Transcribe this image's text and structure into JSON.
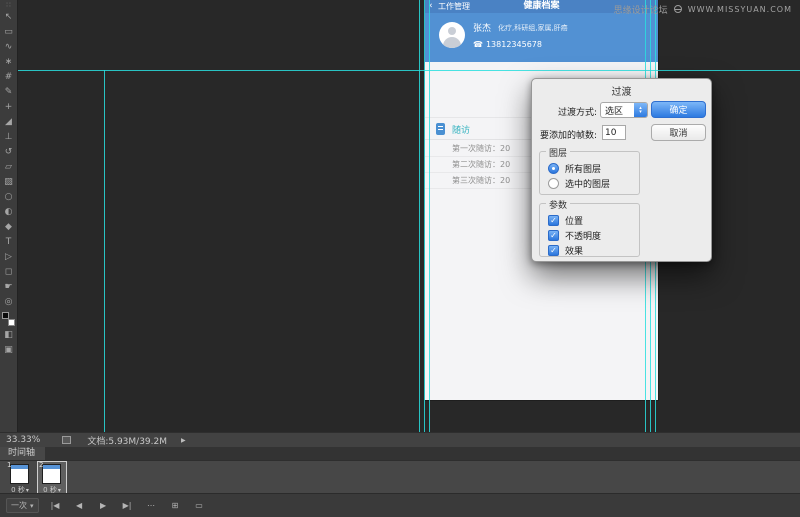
{
  "watermark": {
    "cn": "思缘设计论坛",
    "en": "WWW.MISSYUAN.COM"
  },
  "ps": {
    "tools": [
      {
        "name": "toolbar-grip",
        "glyph": "∷"
      },
      {
        "name": "move-tool",
        "glyph": "↖"
      },
      {
        "name": "marquee-tool",
        "glyph": "▭"
      },
      {
        "name": "lasso-tool",
        "glyph": "∿"
      },
      {
        "name": "magic-wand-tool",
        "glyph": "∗"
      },
      {
        "name": "crop-tool",
        "glyph": "#"
      },
      {
        "name": "eyedropper-tool",
        "glyph": "✎"
      },
      {
        "name": "healing-tool",
        "glyph": "+"
      },
      {
        "name": "brush-tool",
        "glyph": "◢"
      },
      {
        "name": "stamp-tool",
        "glyph": "⊥"
      },
      {
        "name": "history-brush-tool",
        "glyph": "↺"
      },
      {
        "name": "eraser-tool",
        "glyph": "▱"
      },
      {
        "name": "gradient-tool",
        "glyph": "▨"
      },
      {
        "name": "blur-tool",
        "glyph": "○"
      },
      {
        "name": "dodge-tool",
        "glyph": "◐"
      },
      {
        "name": "pen-tool",
        "glyph": "◆"
      },
      {
        "name": "type-tool",
        "glyph": "T"
      },
      {
        "name": "path-select-tool",
        "glyph": "▷"
      },
      {
        "name": "shape-tool",
        "glyph": "◻"
      },
      {
        "name": "hand-tool",
        "glyph": "☛"
      },
      {
        "name": "zoom-tool",
        "glyph": "◎"
      },
      {
        "name": "quick-mask",
        "glyph": "◧"
      },
      {
        "name": "screen-mode",
        "glyph": "▣"
      }
    ],
    "statusbar": {
      "zoom": "33.33%",
      "doc": "文档:5.93M/39.2M",
      "arrow": "▶"
    },
    "timeline": {
      "tab": "时间轴",
      "loop": "一次",
      "loop_caret": "▾",
      "frames": [
        {
          "num": "1",
          "delay": "0 秒",
          "caret": "▾"
        },
        {
          "num": "2",
          "delay": "0 秒",
          "caret": "▾"
        }
      ],
      "controls": [
        {
          "name": "first-frame",
          "glyph": "|◀"
        },
        {
          "name": "prev-frame",
          "glyph": "◀"
        },
        {
          "name": "play",
          "glyph": "▶"
        },
        {
          "name": "next-frame",
          "glyph": "▶|"
        },
        {
          "name": "tween",
          "glyph": "⋯"
        },
        {
          "name": "duplicate-frame",
          "glyph": "⊞"
        },
        {
          "name": "delete-frame",
          "glyph": "▭"
        }
      ]
    }
  },
  "mockup": {
    "nav": {
      "back": "‹",
      "left": "工作管理",
      "title": "健康档案"
    },
    "user": {
      "name": "张杰",
      "tags": "化疗,科研组,家属,肝癌",
      "phone_icon": "☎",
      "phone": "13812345678"
    },
    "section": {
      "label": "随访"
    },
    "rows": [
      "第一次随访：20",
      "第二次随访：20",
      "第三次随访：20"
    ]
  },
  "dialog": {
    "title": "过渡",
    "method_label": "过渡方式:",
    "method_value": "选区",
    "stepper_up": "▴",
    "stepper_down": "▾",
    "frames_label": "要添加的帧数:",
    "frames_value": "10",
    "ok": "确定",
    "cancel": "取消",
    "check_glyph": "✓",
    "layers": {
      "legend": "图层",
      "options": [
        {
          "label": "所有图层",
          "selected": true
        },
        {
          "label": "选中的图层",
          "selected": false
        }
      ]
    },
    "params": {
      "legend": "参数",
      "options": [
        {
          "label": "位置",
          "checked": true
        },
        {
          "label": "不透明度",
          "checked": true
        },
        {
          "label": "效果",
          "checked": true
        }
      ]
    }
  }
}
